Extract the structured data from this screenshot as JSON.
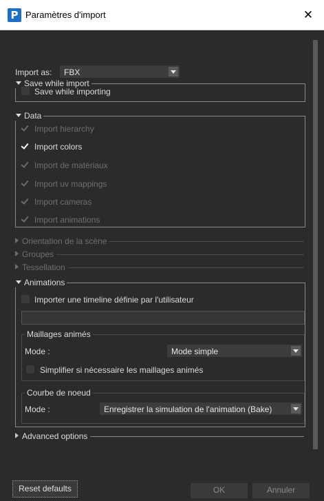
{
  "window": {
    "title": "Paramètres d'import",
    "close_glyph": "✕",
    "icon_letter": "P"
  },
  "import_as": {
    "label": "Import as:",
    "value": "FBX"
  },
  "save_while_import": {
    "title": "Save while import",
    "checkbox_label": "Save while importing",
    "checked": false
  },
  "data": {
    "title": "Data",
    "items": [
      {
        "label": "Import hierarchy",
        "checked": true,
        "enabled": false
      },
      {
        "label": "Import colors",
        "checked": true,
        "enabled": true
      },
      {
        "label": "Import de matériaux",
        "checked": true,
        "enabled": false
      },
      {
        "label": "Import uv mappings",
        "checked": true,
        "enabled": false
      },
      {
        "label": "Import cameras",
        "checked": true,
        "enabled": false
      },
      {
        "label": "Import animations",
        "checked": true,
        "enabled": false
      }
    ]
  },
  "collapsed": {
    "orientation": "Orientation de la scène",
    "groupes": "Groupes",
    "tessellation": "Tessellation"
  },
  "animations": {
    "title": "Animations",
    "timeline_label": "Importer une timeline définie par l'utilisateur",
    "timeline_checked": false,
    "timeline_value": "",
    "maillages": {
      "title": "Maillages animés",
      "mode_label": "Mode :",
      "mode_value": "Mode simple",
      "simplify_label": "Simplifier si nécessaire les maillages animés",
      "simplify_checked": false
    },
    "courbe": {
      "title": "Courbe de noeud",
      "mode_label": "Mode :",
      "mode_value": "Enregistrer la simulation de l'animation (Bake)"
    }
  },
  "advanced": {
    "label": "Advanced options"
  },
  "buttons": {
    "reset": "Reset defaults",
    "ok": "OK",
    "cancel": "Annuler"
  },
  "colors": {
    "background": "#2b2b2b",
    "titlebar": "#ffffff",
    "app_icon": "#1e6fc8"
  }
}
